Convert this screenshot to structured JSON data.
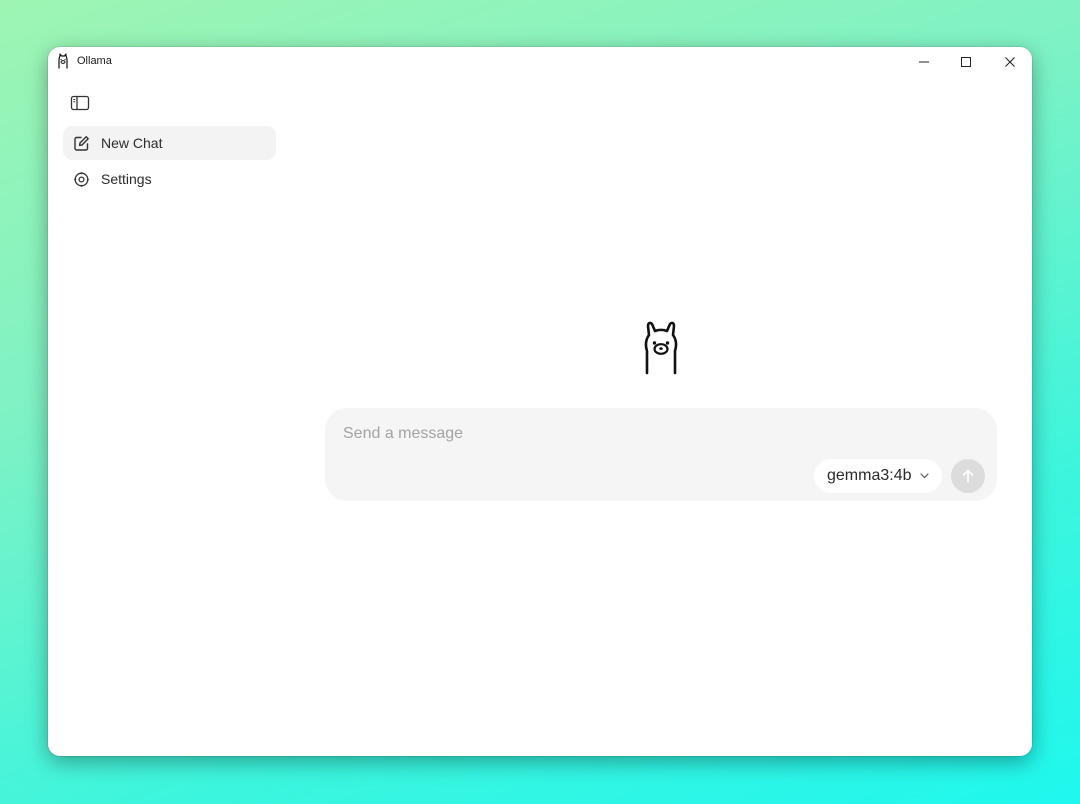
{
  "window": {
    "title": "Ollama"
  },
  "sidebar": {
    "toggle_icon": "sidebar-panel-icon",
    "items": [
      {
        "label": "New Chat",
        "icon": "edit-icon",
        "active": true
      },
      {
        "label": "Settings",
        "icon": "gear-icon",
        "active": false
      }
    ]
  },
  "composer": {
    "value": "",
    "placeholder": "Send a message",
    "model": "gemma3:4b",
    "send_icon": "arrow-up-icon"
  },
  "colors": {
    "composer_bg": "#f5f5f5",
    "active_item_bg": "#f3f3f3",
    "send_button_disabled": "#dcdcdc"
  }
}
